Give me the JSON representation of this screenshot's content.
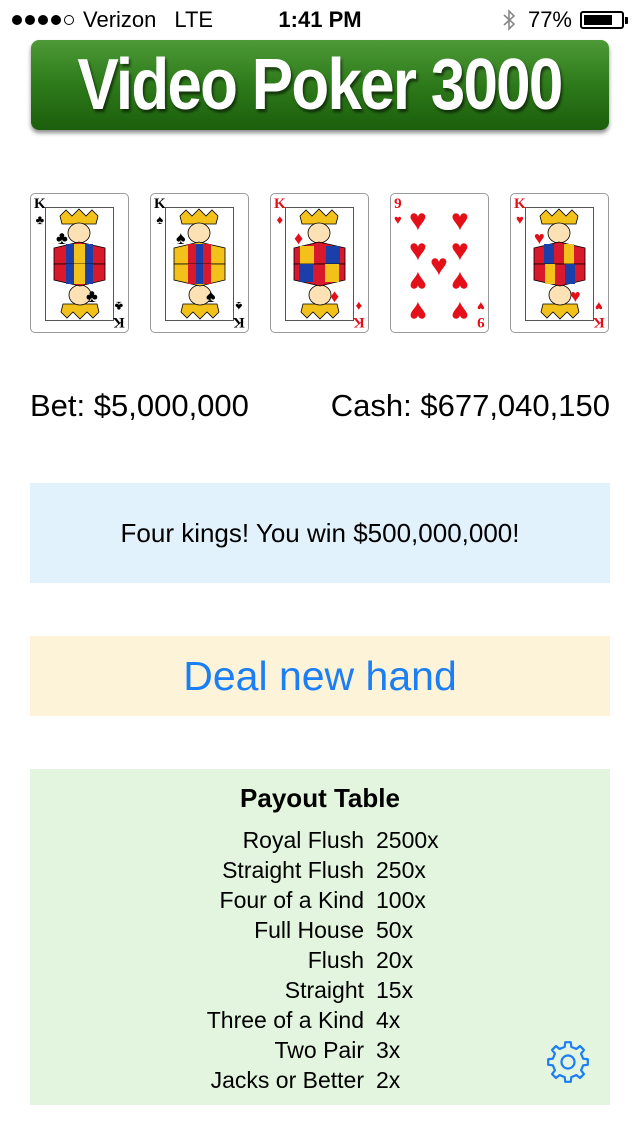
{
  "status_bar": {
    "carrier": "Verizon",
    "network": "LTE",
    "time": "1:41 PM",
    "battery": "77%",
    "battery_level": 0.77,
    "signal_bars": 4,
    "signal_total": 5,
    "icons": [
      "signal-dots-icon",
      "bluetooth-icon",
      "battery-icon"
    ]
  },
  "title": "Video Poker 3000",
  "colors": {
    "banner_green": "#2d7a1a",
    "red_suit": "#e3101a",
    "message_bg": "#e2f2fc",
    "deal_bg": "#fdf3d8",
    "deal_text": "#1b7ef5",
    "payout_bg": "#e3f5de",
    "gear": "#1b7ef5"
  },
  "cards": [
    {
      "rank": "K",
      "suit": "♣",
      "color": "black",
      "type": "king-of-clubs"
    },
    {
      "rank": "K",
      "suit": "♠",
      "color": "black",
      "type": "king-of-spades"
    },
    {
      "rank": "K",
      "suit": "♦",
      "color": "red",
      "type": "king-of-diamonds"
    },
    {
      "rank": "9",
      "suit": "♥",
      "color": "red",
      "type": "nine-of-hearts"
    },
    {
      "rank": "K",
      "suit": "♥",
      "color": "red",
      "type": "king-of-hearts"
    }
  ],
  "bet": "Bet: $5,000,000",
  "cash": "Cash: $677,040,150",
  "message": "Four kings! You win $500,000,000!",
  "deal_button_label": "Deal new hand",
  "payout": {
    "title": "Payout Table",
    "rows": [
      {
        "hand": "Royal Flush",
        "multiplier": "2500x"
      },
      {
        "hand": "Straight Flush",
        "multiplier": "250x"
      },
      {
        "hand": "Four of a Kind",
        "multiplier": "100x"
      },
      {
        "hand": "Full House",
        "multiplier": "50x"
      },
      {
        "hand": "Flush",
        "multiplier": "20x"
      },
      {
        "hand": "Straight",
        "multiplier": "15x"
      },
      {
        "hand": "Three of a Kind",
        "multiplier": "4x"
      },
      {
        "hand": "Two Pair",
        "multiplier": "3x"
      },
      {
        "hand": "Jacks or Better",
        "multiplier": "2x"
      }
    ]
  },
  "settings_icon": "gear-icon"
}
